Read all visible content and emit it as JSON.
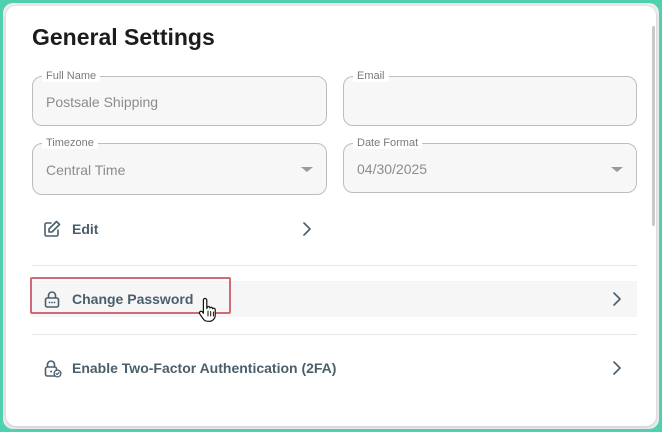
{
  "page": {
    "title": "General Settings"
  },
  "fields": {
    "full_name": {
      "label": "Full Name",
      "value": "Postsale Shipping"
    },
    "email": {
      "label": "Email",
      "value": ""
    },
    "timezone": {
      "label": "Timezone",
      "value": "Central Time"
    },
    "date_format": {
      "label": "Date Format",
      "value": "04/30/2025"
    }
  },
  "actions": {
    "edit": {
      "label": "Edit",
      "icon": "pencil-icon"
    },
    "change_password": {
      "label": "Change Password",
      "icon": "lock-icon"
    },
    "two_factor": {
      "label": "Enable Two-Factor Authentication (2FA)",
      "icon": "lock-check-icon"
    }
  },
  "colors": {
    "background_accent": "#4fd1b0",
    "highlight": "#d06a76",
    "action_text": "#4a5e6b"
  }
}
